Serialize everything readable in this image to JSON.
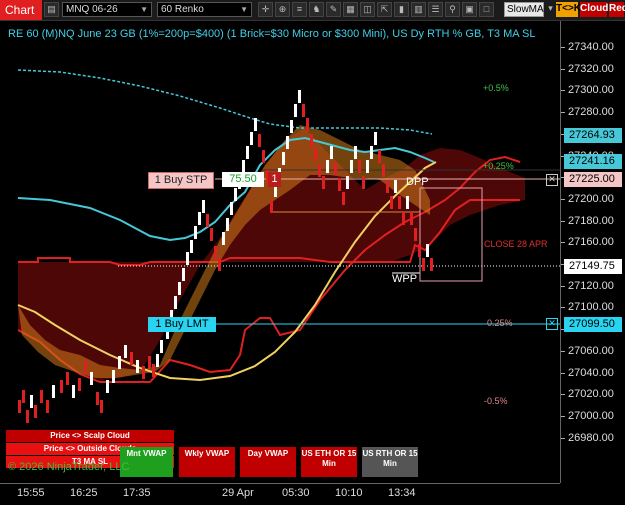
{
  "toolbar": {
    "chart_tab": "Chart",
    "instrument": "MNQ 06-26",
    "period": "60 Renko",
    "indicator": "SlowMA",
    "btn_tck": "T<>K",
    "btn_cloud": "Cloud",
    "btn_red": "Red"
  },
  "chart": {
    "title": "RE 60 (M)NQ June 23 GB (1%=200p=$400) (1 Brick=$30 Micro or $300 Mini), US Dy RTH % GB, T3 MA SL",
    "pct_plus_half": "+0.5%",
    "pct_plus_quarter": "+0.25%",
    "pct_quarter": "0.25%",
    "pct_minus_half": "-0.5%",
    "close_label": "CLOSE 28 APR",
    "dpp_label": "DPP",
    "wpp_label": "WPP",
    "copyright": "© 2026 NinjaTrader, LLC"
  },
  "orders": {
    "buy_stop_label": "1 Buy STP",
    "buy_stop_price": "75.50",
    "buy_stop_qty": "1",
    "buy_limit_label": "1 Buy LMT"
  },
  "price_axis": {
    "ticks": [
      "27340.00",
      "27320.00",
      "27300.00",
      "27280.00",
      "27260.00",
      "27240.00",
      "27220.00",
      "27200.00",
      "27180.00",
      "27160.00",
      "27140.00",
      "27120.00",
      "27100.00",
      "27080.00",
      "27060.00",
      "27040.00",
      "27020.00",
      "27000.00",
      "26980.00"
    ],
    "labels": {
      "slow_ma": "27264.93",
      "ma": "27241.16",
      "buy_stop": "27225.00",
      "last": "27149.75",
      "buy_limit": "27099.50"
    }
  },
  "time_axis": [
    "15:55",
    "16:25",
    "17:35",
    "29 Apr",
    "05:30",
    "10:10",
    "13:34"
  ],
  "panels": {
    "scalp": "Price <> Scalp Cloud",
    "outside": "Price <> Outside Clouds",
    "t3": "T3 MA SL",
    "mnt_vwap": "Mnt VWAP",
    "wkly_vwap": "Wkly VWAP",
    "day_vwap": "Day VWAP",
    "eth_or": "US ETH OR 15 Min",
    "rth_or": "US RTH OR 15 Min"
  },
  "colors": {
    "price_axis_border": "#666666",
    "title": "#3fd0e6",
    "bull_brick": "#ffffff",
    "bear_brick": "#e02020",
    "buy_limit": "#28d4f0",
    "buy_stop": "#f4c6c6"
  }
}
